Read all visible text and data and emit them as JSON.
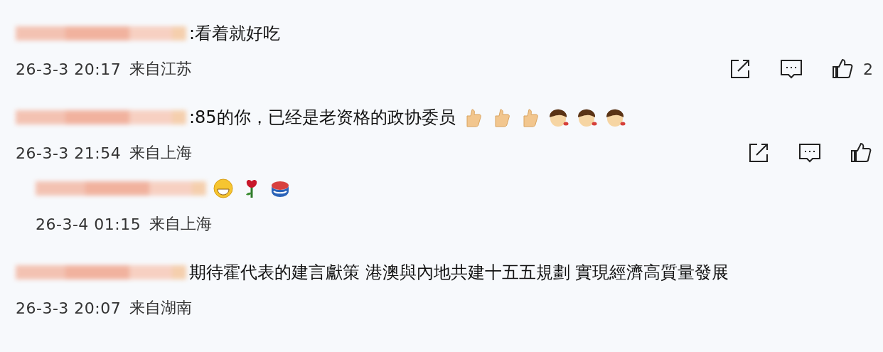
{
  "comments": [
    {
      "text": ":看着就好吃",
      "time": "26-3-3 20:17",
      "location": "来自江苏",
      "actions": true,
      "like_count": "2"
    },
    {
      "text": ":85的你，已经是老资格的政协委员",
      "emojis": [
        {
          "kind": "thumbs-up"
        },
        {
          "kind": "thumbs-up"
        },
        {
          "kind": "thumbs-up"
        },
        {
          "kind": "boy"
        },
        {
          "kind": "boy"
        },
        {
          "kind": "boy"
        }
      ],
      "time": "26-3-3 21:54",
      "location": "来自上海",
      "actions": true,
      "children": [
        {
          "emojis": [
            {
              "kind": "grin"
            },
            {
              "kind": "rose"
            },
            {
              "kind": "bowl"
            }
          ],
          "time": "26-3-4 01:15",
          "location": "来自上海",
          "actions": false
        }
      ]
    },
    {
      "text": "期待霍代表的建言獻策 港澳與內地共建十五五規劃 實現經濟高質量發展",
      "time": "26-3-3 20:07",
      "location": "来自湖南",
      "actions": false
    }
  ]
}
